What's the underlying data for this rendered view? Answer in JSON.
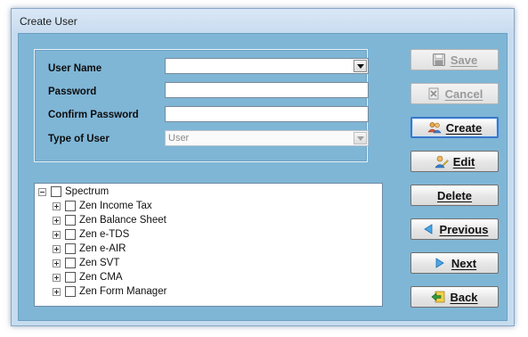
{
  "window": {
    "title": "Create User"
  },
  "form": {
    "fields": [
      {
        "label": "User Name",
        "value": "",
        "kind": "combo"
      },
      {
        "label": "Password",
        "value": "",
        "kind": "text"
      },
      {
        "label": "Confirm Password",
        "value": "",
        "kind": "text"
      },
      {
        "label": "Type of User",
        "value": "User",
        "kind": "combo-disabled"
      }
    ]
  },
  "tree": {
    "root": "Spectrum",
    "children": [
      "Zen Income Tax",
      "Zen Balance Sheet",
      "Zen e-TDS",
      "Zen e-AIR",
      "Zen SVT",
      "Zen CMA",
      "Zen Form Manager"
    ]
  },
  "buttons": {
    "save": {
      "label": "Save",
      "icon": "floppy-disk-icon",
      "enabled": false
    },
    "cancel": {
      "label": "Cancel",
      "icon": "cancel-doc-icon",
      "enabled": false
    },
    "create": {
      "label": "Create",
      "icon": "users-icon",
      "enabled": true
    },
    "edit": {
      "label": "Edit",
      "icon": "user-edit-icon",
      "enabled": true
    },
    "delete": {
      "label": "Delete",
      "enabled": true
    },
    "previous": {
      "label": "Previous",
      "icon": "triangle-left-icon",
      "enabled": true
    },
    "next": {
      "label": "Next",
      "icon": "triangle-right-icon",
      "enabled": true
    },
    "back": {
      "label": "Back",
      "icon": "back-arrow-icon",
      "enabled": true
    }
  },
  "colors": {
    "client_bg": "#7fb6d6",
    "window_bg": "#c6dcef",
    "accent_blue": "#3a78c8"
  }
}
